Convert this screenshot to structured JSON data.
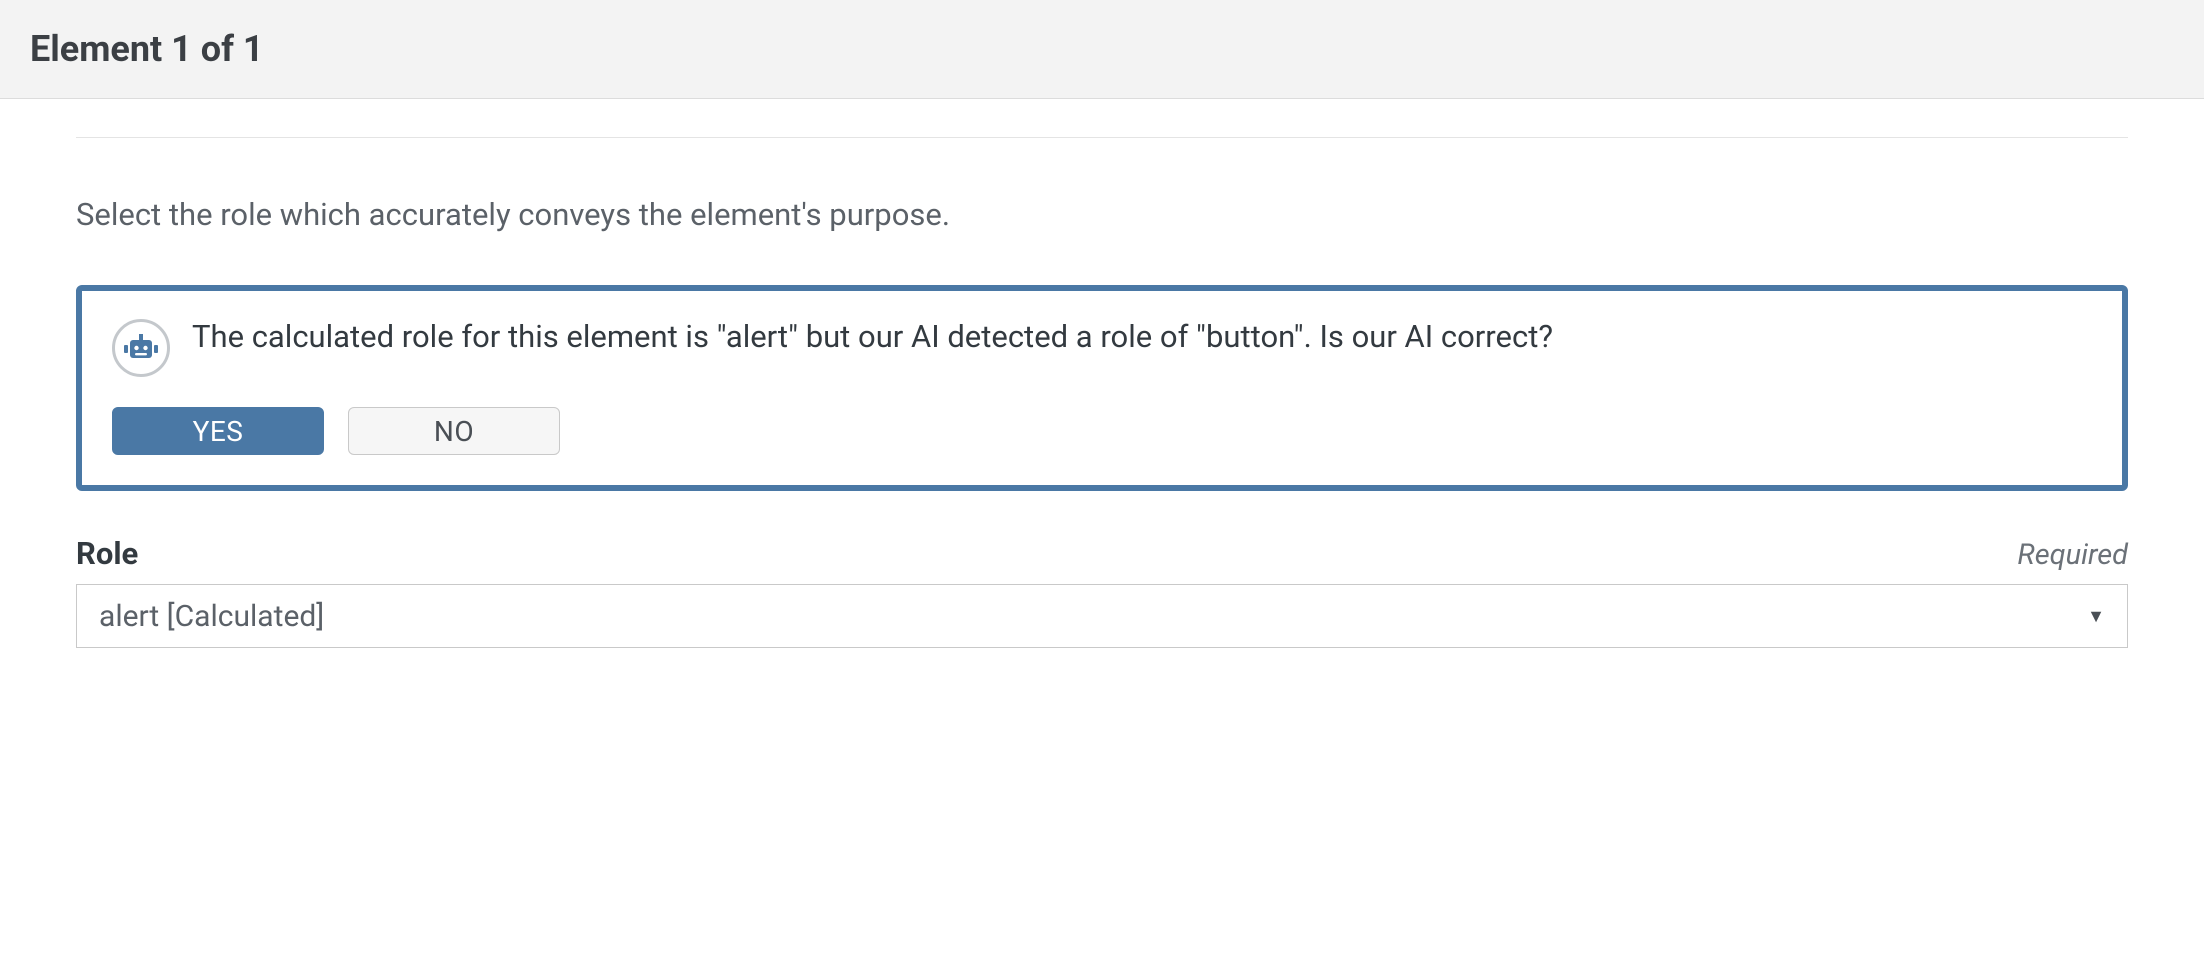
{
  "header": {
    "title": "Element 1 of 1"
  },
  "instruction": "Select the role which accurately conveys the element's purpose.",
  "ai_box": {
    "message": "The calculated role for this element is \"alert\" but our AI detected a role of \"button\". Is our AI correct?",
    "yes_label": "YES",
    "no_label": "NO"
  },
  "role_field": {
    "label": "Role",
    "required_label": "Required",
    "selected_value": "alert [Calculated]"
  },
  "colors": {
    "accent": "#4a78a5",
    "header_bg": "#f3f3f3"
  }
}
